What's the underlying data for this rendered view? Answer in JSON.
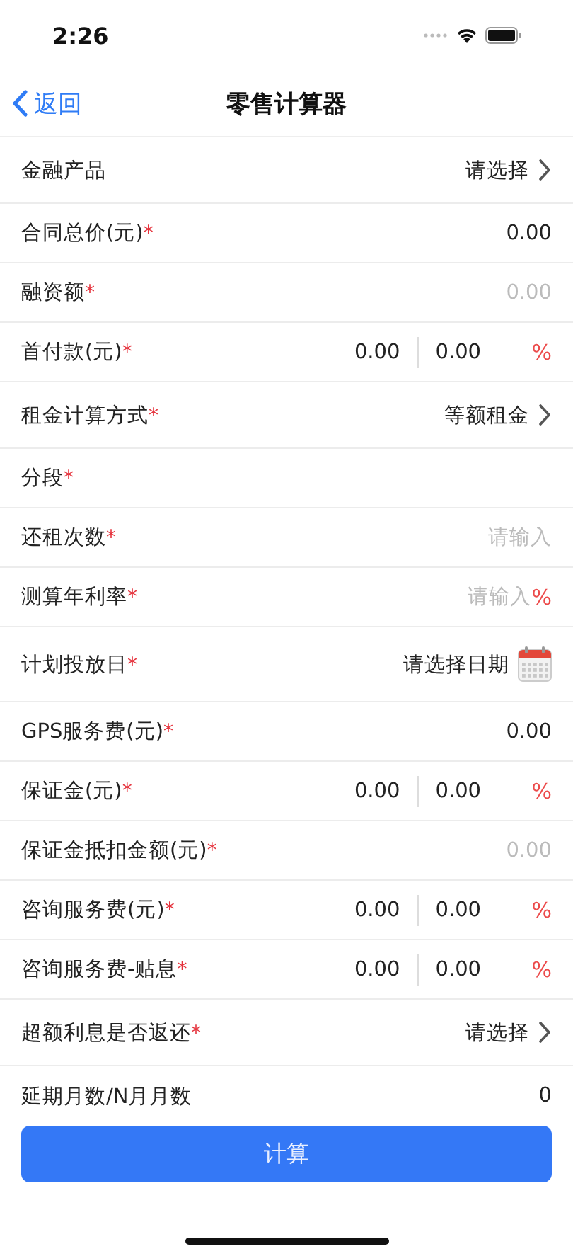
{
  "status_bar": {
    "time": "2:26"
  },
  "nav": {
    "back": "返回",
    "title": "零售计算器"
  },
  "rows": [
    {
      "kind": "select",
      "label": "金融产品",
      "value": "请选择"
    },
    {
      "kind": "input",
      "label": "合同总价(元)",
      "mark": "*",
      "value": "0.00"
    },
    {
      "kind": "input",
      "label": "融资额",
      "mark": "*",
      "placeholder": "0.00"
    },
    {
      "kind": "split",
      "label": "首付款(元)",
      "mark": "*",
      "value": "0.00",
      "second_value": "0.00",
      "unit": "%"
    },
    {
      "kind": "select",
      "label": "租金计算方式",
      "mark": "*",
      "value": "等额租金"
    },
    {
      "kind": "blank",
      "label": "分段",
      "mark": "*"
    },
    {
      "kind": "input",
      "label": "还租次数",
      "mark": "*",
      "placeholder": "请输入"
    },
    {
      "kind": "input",
      "label": "测算年利率",
      "mark": "*",
      "placeholder": "请输入",
      "unit": "%"
    },
    {
      "kind": "date",
      "label": "计划投放日",
      "mark": "*",
      "value": "请选择日期"
    },
    {
      "kind": "input",
      "label": "GPS服务费(元)",
      "mark": "*",
      "value": "0.00"
    },
    {
      "kind": "split",
      "label": "保证金(元)",
      "mark": "*",
      "value": "0.00",
      "second_value": "0.00",
      "unit": "%"
    },
    {
      "kind": "input",
      "label": "保证金抵扣金额(元)",
      "mark": "*",
      "placeholder": "0.00"
    },
    {
      "kind": "split",
      "label": "咨询服务费(元)",
      "mark": "*",
      "value": "0.00",
      "second_value": "0.00",
      "unit": "%"
    },
    {
      "kind": "split",
      "label": "咨询服务费-贴息",
      "mark": "*",
      "value": "0.00",
      "second_value": "0.00",
      "unit": "%"
    },
    {
      "kind": "select",
      "label": "超额利息是否返还",
      "mark": "*",
      "value": "请选择"
    },
    {
      "kind": "input",
      "label": "延期月数/N月月数",
      "value": "0"
    }
  ],
  "submit": "计算"
}
